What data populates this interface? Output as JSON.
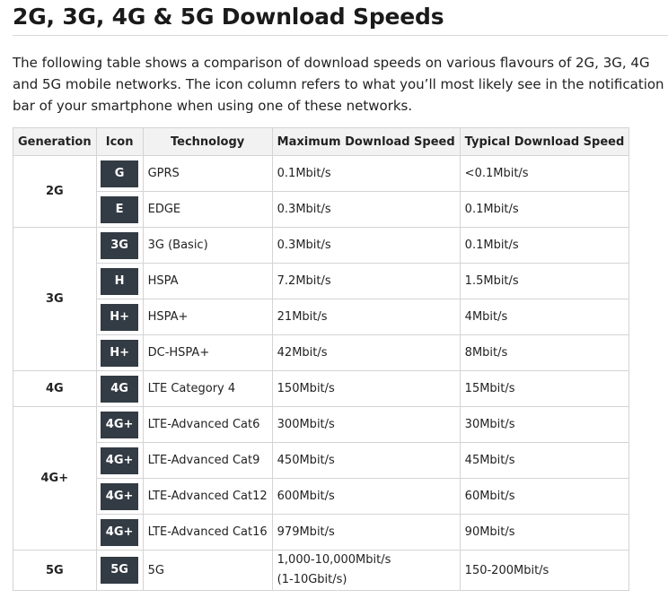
{
  "title": "2G, 3G, 4G & 5G Download Speeds",
  "intro": "The following table shows a comparison of download speeds on various flavours of 2G, 3G, 4G and 5G mobile networks. The icon column refers to what you’ll most likely see in the notification bar of your smartphone when using one of these networks.",
  "table": {
    "headers": [
      "Generation",
      "Icon",
      "Technology",
      "Maximum Download Speed",
      "Typical Download Speed"
    ],
    "groups": [
      {
        "generation": "2G",
        "rows": [
          {
            "icon": "G",
            "technology": "GPRS",
            "max": "0.1Mbit/s",
            "typical": "<0.1Mbit/s"
          },
          {
            "icon": "E",
            "technology": "EDGE",
            "max": "0.3Mbit/s",
            "typical": "0.1Mbit/s"
          }
        ]
      },
      {
        "generation": "3G",
        "rows": [
          {
            "icon": "3G",
            "technology": "3G (Basic)",
            "max": "0.3Mbit/s",
            "typical": "0.1Mbit/s"
          },
          {
            "icon": "H",
            "technology": "HSPA",
            "max": "7.2Mbit/s",
            "typical": "1.5Mbit/s"
          },
          {
            "icon": "H+",
            "technology": "HSPA+",
            "max": "21Mbit/s",
            "typical": "4Mbit/s"
          },
          {
            "icon": "H+",
            "technology": "DC-HSPA+",
            "max": "42Mbit/s",
            "typical": "8Mbit/s"
          }
        ]
      },
      {
        "generation": "4G",
        "rows": [
          {
            "icon": "4G",
            "technology": "LTE Category 4",
            "max": "150Mbit/s",
            "typical": "15Mbit/s"
          }
        ]
      },
      {
        "generation": "4G+",
        "rows": [
          {
            "icon": "4G+",
            "technology": "LTE-Advanced Cat6",
            "max": "300Mbit/s",
            "typical": "30Mbit/s"
          },
          {
            "icon": "4G+",
            "technology": "LTE-Advanced Cat9",
            "max": "450Mbit/s",
            "typical": "45Mbit/s"
          },
          {
            "icon": "4G+",
            "technology": "LTE-Advanced Cat12",
            "max": "600Mbit/s",
            "typical": "60Mbit/s"
          },
          {
            "icon": "4G+",
            "technology": "LTE-Advanced Cat16",
            "max": "979Mbit/s",
            "typical": "90Mbit/s"
          }
        ]
      },
      {
        "generation": "5G",
        "rows": [
          {
            "icon": "5G",
            "technology": "5G",
            "max": "1,000-10,000Mbit/s",
            "max_line2": "(1-10Gbit/s)",
            "typical": "150-200Mbit/s"
          }
        ]
      }
    ]
  }
}
